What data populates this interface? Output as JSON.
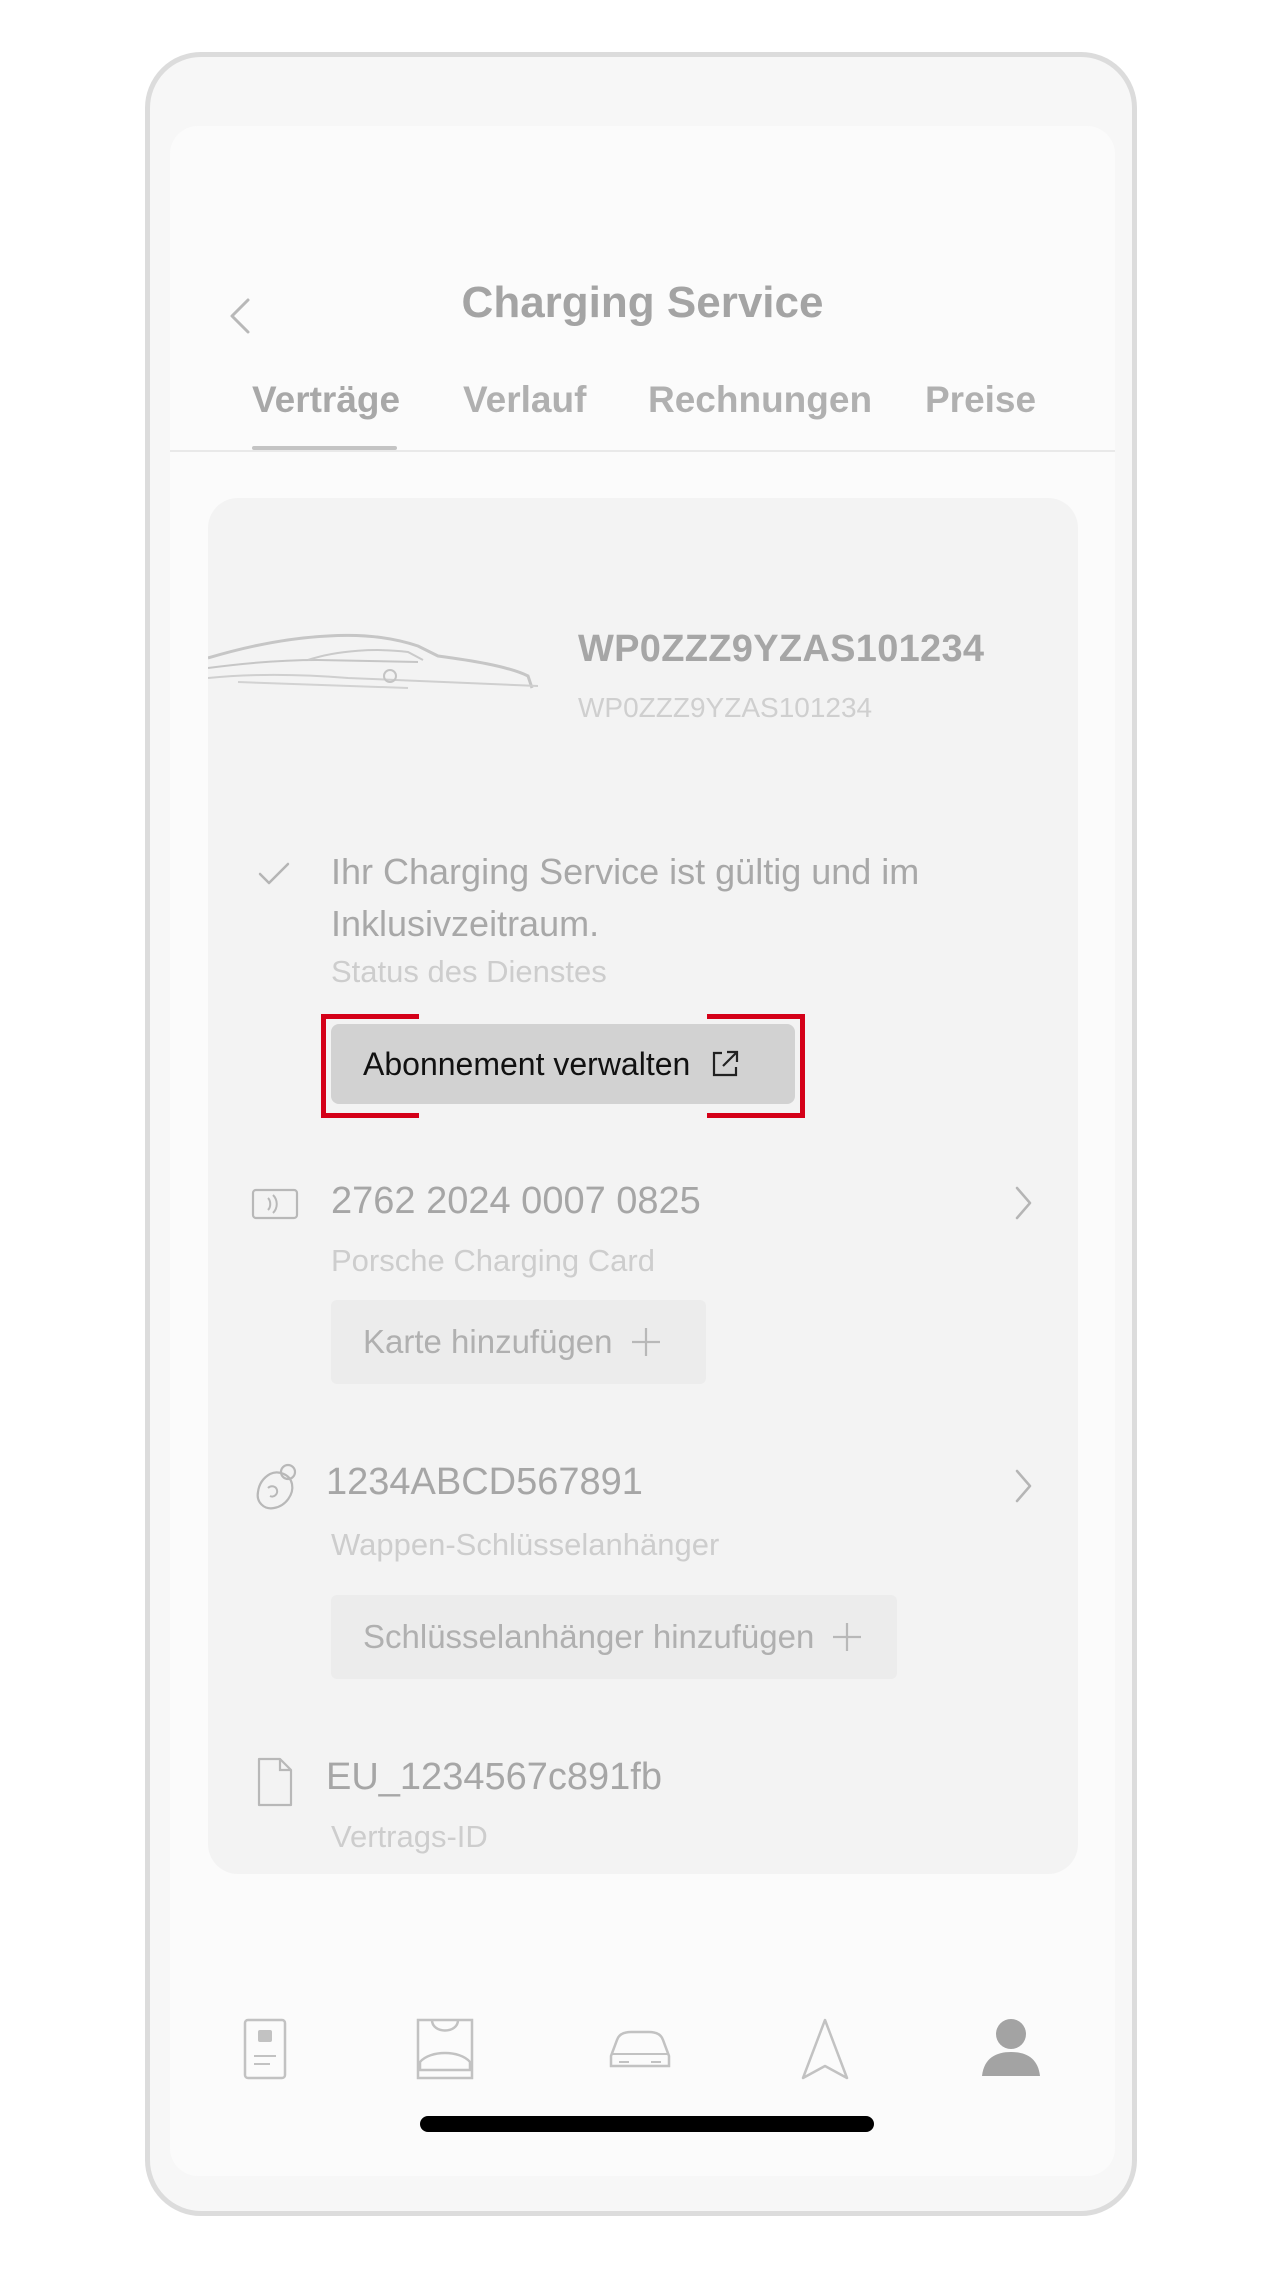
{
  "header": {
    "title": "Charging Service",
    "tabs": [
      {
        "label": "Verträge",
        "active": true
      },
      {
        "label": "Verlauf",
        "active": false
      },
      {
        "label": "Rechnungen",
        "active": false
      },
      {
        "label": "Preise",
        "active": false
      }
    ]
  },
  "vehicle": {
    "vin": "WP0ZZZ9YZAS101234",
    "vin_secondary": "WP0ZZZ9YZAS101234",
    "image_icon": "car-silhouette"
  },
  "status": {
    "text": "Ihr Charging Service ist gültig und im Inklusivzeitraum.",
    "label": "Status des Dienstes",
    "icon": "check-icon"
  },
  "manage_button": {
    "label": "Abonnement verwalten",
    "icon": "external-link-icon",
    "highlight_color": "#d40018"
  },
  "charging_card": {
    "number": "2762 2024 0007 0825",
    "label": "Porsche Charging Card",
    "add_label": "Karte hinzufügen"
  },
  "key_fob": {
    "number": "1234ABCD567891",
    "label": "Wappen-Schlüsselanhänger",
    "add_label": "Schlüsselanhänger hinzufügen"
  },
  "contract": {
    "id": "EU_1234567c891fb",
    "label": "Vertrags-ID"
  },
  "bottom_nav": [
    {
      "icon": "phone-key-icon",
      "active": false
    },
    {
      "icon": "vehicle-store-icon",
      "active": false
    },
    {
      "icon": "car-icon",
      "active": false
    },
    {
      "icon": "navigation-arrow-icon",
      "active": false
    },
    {
      "icon": "profile-icon",
      "active": true
    }
  ]
}
